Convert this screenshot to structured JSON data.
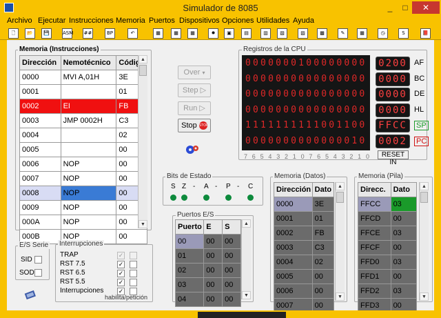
{
  "window": {
    "title": "Simulador de 8085",
    "min": "_",
    "max": "□",
    "close": "✕"
  },
  "menu": [
    "Archivo",
    "Ejecutar",
    "Instrucciones",
    "Memoria",
    "Puertos",
    "Dispositivos",
    "Opciones",
    "Utilidades",
    "Ayuda"
  ],
  "toolbar": [
    {
      "name": "new-file-icon",
      "glyph": "🗋"
    },
    {
      "name": "open-file-icon",
      "glyph": "📂"
    },
    {
      "name": "save-file-icon",
      "glyph": "💾"
    },
    {
      "name": "asm-icon",
      "glyph": "ASM"
    },
    {
      "name": "hash-icon",
      "glyph": "##"
    },
    {
      "name": "breakpoint-icon",
      "glyph": "BP"
    },
    {
      "name": "undo-icon",
      "glyph": "↶"
    },
    {
      "name": "memory-red-icon",
      "glyph": "▦"
    },
    {
      "name": "memory-red-2-icon",
      "glyph": "▦"
    },
    {
      "name": "memory-red-3-icon",
      "glyph": "▦"
    },
    {
      "name": "led-device-icon",
      "glyph": "✹"
    },
    {
      "name": "chip-device-icon",
      "glyph": "▣"
    },
    {
      "name": "display-device-icon",
      "glyph": "▤"
    },
    {
      "name": "battery-device-icon",
      "glyph": "▥"
    },
    {
      "name": "keyboard-device-icon",
      "glyph": "▧"
    },
    {
      "name": "terminal-device-icon",
      "glyph": "▨"
    },
    {
      "name": "switch-device-icon",
      "glyph": "▩"
    },
    {
      "name": "draw-icon",
      "glyph": "✎"
    },
    {
      "name": "calc-icon",
      "glyph": "▦"
    },
    {
      "name": "clock-icon",
      "glyph": "◷"
    },
    {
      "name": "about-icon",
      "glyph": "S"
    },
    {
      "name": "book-icon",
      "glyph": "📕"
    }
  ],
  "mem_instr": {
    "title": "Memoria (Instrucciones)",
    "headers": [
      "Dirección",
      "Nemotécnico",
      "Código"
    ],
    "rows": [
      [
        "0000",
        "MVI A,01H",
        "3E"
      ],
      [
        "0001",
        "",
        "01"
      ],
      [
        "0002",
        "EI",
        "FB"
      ],
      [
        "0003",
        "JMP 0002H",
        "C3"
      ],
      [
        "0004",
        "",
        "02"
      ],
      [
        "0005",
        "",
        "00"
      ],
      [
        "0006",
        "NOP",
        "00"
      ],
      [
        "0007",
        "NOP",
        "00"
      ],
      [
        "0008",
        "NOP",
        "00"
      ],
      [
        "0009",
        "NOP",
        "00"
      ],
      [
        "000A",
        "NOP",
        "00"
      ],
      [
        "000B",
        "NOP",
        "00"
      ]
    ]
  },
  "controls": {
    "over": "Over",
    "step": "Step",
    "run": "Run",
    "stop": "Stop",
    "stop_sign": "STOP"
  },
  "registers": {
    "title": "Registros de la CPU",
    "rows": [
      {
        "bits": "0000000100000000",
        "hex": "0200",
        "label": "AF"
      },
      {
        "bits": "0000000000000000",
        "hex": "0000",
        "label": "BC"
      },
      {
        "bits": "0000000000000000",
        "hex": "0000",
        "label": "DE"
      },
      {
        "bits": "0000000000000000",
        "hex": "0000",
        "label": "HL"
      },
      {
        "bits": "1111111111001100",
        "hex": "FFCC",
        "label": "SP"
      },
      {
        "bits": "0000000000000010",
        "hex": "0002",
        "label": "PC"
      }
    ],
    "bit_index": [
      "7",
      "6",
      "5",
      "4",
      "3",
      "2",
      "1",
      "0",
      "7",
      "6",
      "5",
      "4",
      "3",
      "2",
      "1",
      "0"
    ],
    "reset": "RESET IN",
    "sp_color": "#1a9a2a",
    "pc_color": "#d01010",
    "led_color": "#e02828"
  },
  "flags": {
    "title": "Bits de Estado",
    "items": [
      "S",
      "Z",
      "-",
      "A",
      "-",
      "P",
      "-",
      "C"
    ]
  },
  "ports": {
    "title": "Puertos E/S",
    "headers": [
      "Puerto",
      "E",
      "S"
    ],
    "rows": [
      [
        "00",
        "00",
        "00"
      ],
      [
        "01",
        "00",
        "00"
      ],
      [
        "02",
        "00",
        "00"
      ],
      [
        "03",
        "00",
        "00"
      ],
      [
        "04",
        "00",
        "00"
      ]
    ]
  },
  "mem_data": {
    "title": "Memoria (Datos)",
    "headers": [
      "Dirección",
      "Dato"
    ],
    "rows": [
      [
        "0000",
        "3E"
      ],
      [
        "0001",
        "01"
      ],
      [
        "0002",
        "FB"
      ],
      [
        "0003",
        "C3"
      ],
      [
        "0004",
        "02"
      ],
      [
        "0005",
        "00"
      ],
      [
        "0006",
        "00"
      ],
      [
        "0007",
        "00"
      ]
    ]
  },
  "mem_stack": {
    "title": "Memoria (Pila)",
    "headers": [
      "Direcc.",
      "Dato"
    ],
    "rows": [
      [
        "FFCC",
        "03"
      ],
      [
        "FFCD",
        "00"
      ],
      [
        "FFCE",
        "03"
      ],
      [
        "FFCF",
        "00"
      ],
      [
        "FFD0",
        "03"
      ],
      [
        "FFD1",
        "00"
      ],
      [
        "FFD2",
        "03"
      ],
      [
        "FFD3",
        "00"
      ]
    ]
  },
  "serial": {
    "title": "E/S Serie",
    "sid": "SID",
    "sod": "SOD"
  },
  "interrupts": {
    "title": "Interrupciones",
    "items": [
      {
        "label": "TRAP",
        "enabled": true,
        "pending": false,
        "disabled": true
      },
      {
        "label": "RST 7.5",
        "enabled": true,
        "pending": false,
        "disabled": false
      },
      {
        "label": "RST 6.5",
        "enabled": true,
        "pending": false,
        "disabled": false
      },
      {
        "label": "RST 5.5",
        "enabled": true,
        "pending": false,
        "disabled": false
      },
      {
        "label": "Interrupciones",
        "enabled": true,
        "pending": false,
        "disabled": false
      }
    ],
    "footer": "habilita/petición"
  }
}
